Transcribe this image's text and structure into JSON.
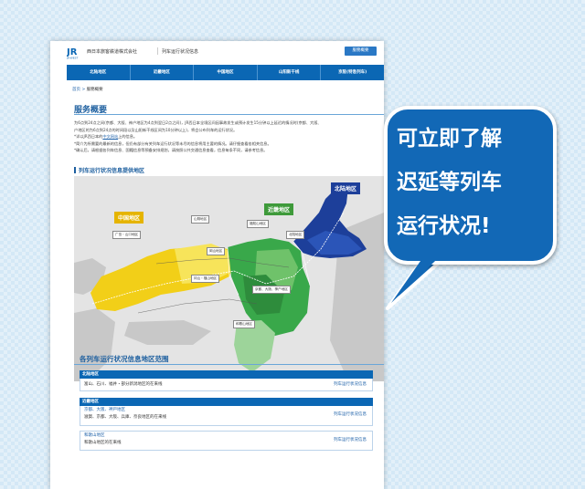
{
  "header": {
    "company": "西日本旅客鉄道株式会社",
    "service": "列车运行状况信息",
    "menu_button": "服務概要"
  },
  "nav": {
    "items": [
      "北陆地区",
      "近畿地区",
      "中国地区",
      "山阳新干线",
      "京阪(特急列车)"
    ]
  },
  "breadcrumb": {
    "home": "首页",
    "separator": ">",
    "current": "服務概要"
  },
  "page_title": "服务概要",
  "description": {
    "line1": "为6点到24点之间(京都、大阪、神户地区为4点到翌日2点之间)，JR西日本全境区间因事故发生或预计发生15分钟以上延迟的情况时(京都、大阪、",
    "line2": "户地区的为6点到24点的时间段以及山阳新干线区间为10分钟以上)，将会公布列车的运行状况。",
    "line3_prefix": "*详以JR西日本的",
    "line3_link": "中文网站",
    "line3_suffix": "上的信息。",
    "line4": "*简介为所需要的最新的信息，但仍有部分有关列车运行状况等未尽的信息将用主要的情况。请仔细查看各相关信息。",
    "line5": "*确认后，请根据各列车信息、国籍信息等预备安排规划，请按照公共交通信息查看，信息每条不同，请参考信息。"
  },
  "map_section": {
    "title": "列车运行状况信息提供地区",
    "regions": {
      "hokuriku": "北陆地区",
      "chugoku": "中国地区",
      "kinki": "近畿地区"
    },
    "place_labels": {
      "hiroshima": "广岛・山口地区",
      "sanin": "山阴地区",
      "okayama": "冈山・福山地区",
      "hokuriku_area": "北陆地区",
      "kyoto": "京都、大阪、神户地区",
      "wakayama": "和歌山地区",
      "fukuchiyama": "福知山地区",
      "kinan": "岡山地区"
    },
    "colors": {
      "chugoku": "#f2cf18",
      "kinki": "#39a84a",
      "hokuriku": "#1d3f9a"
    }
  },
  "range_section": {
    "title": "各列车运行状况信息地区范围",
    "link_label": "列车运行状况信息",
    "rows": [
      {
        "header": "北陆地区",
        "region": "富山、石川、福井・",
        "detail": "部分新潟地区的在来线"
      },
      {
        "header": "近畿地区",
        "region": "京都、大阪、神戸地区",
        "detail": "滋賀、京都、大阪、兵庫、奈良地区的在来线"
      },
      {
        "header": "和歌山地区",
        "region": "",
        "detail": "和歌山地区的在来线"
      }
    ]
  },
  "callout": {
    "line1": "可立即了解",
    "line2": "迟延等列车",
    "line3": "运行状况!"
  }
}
